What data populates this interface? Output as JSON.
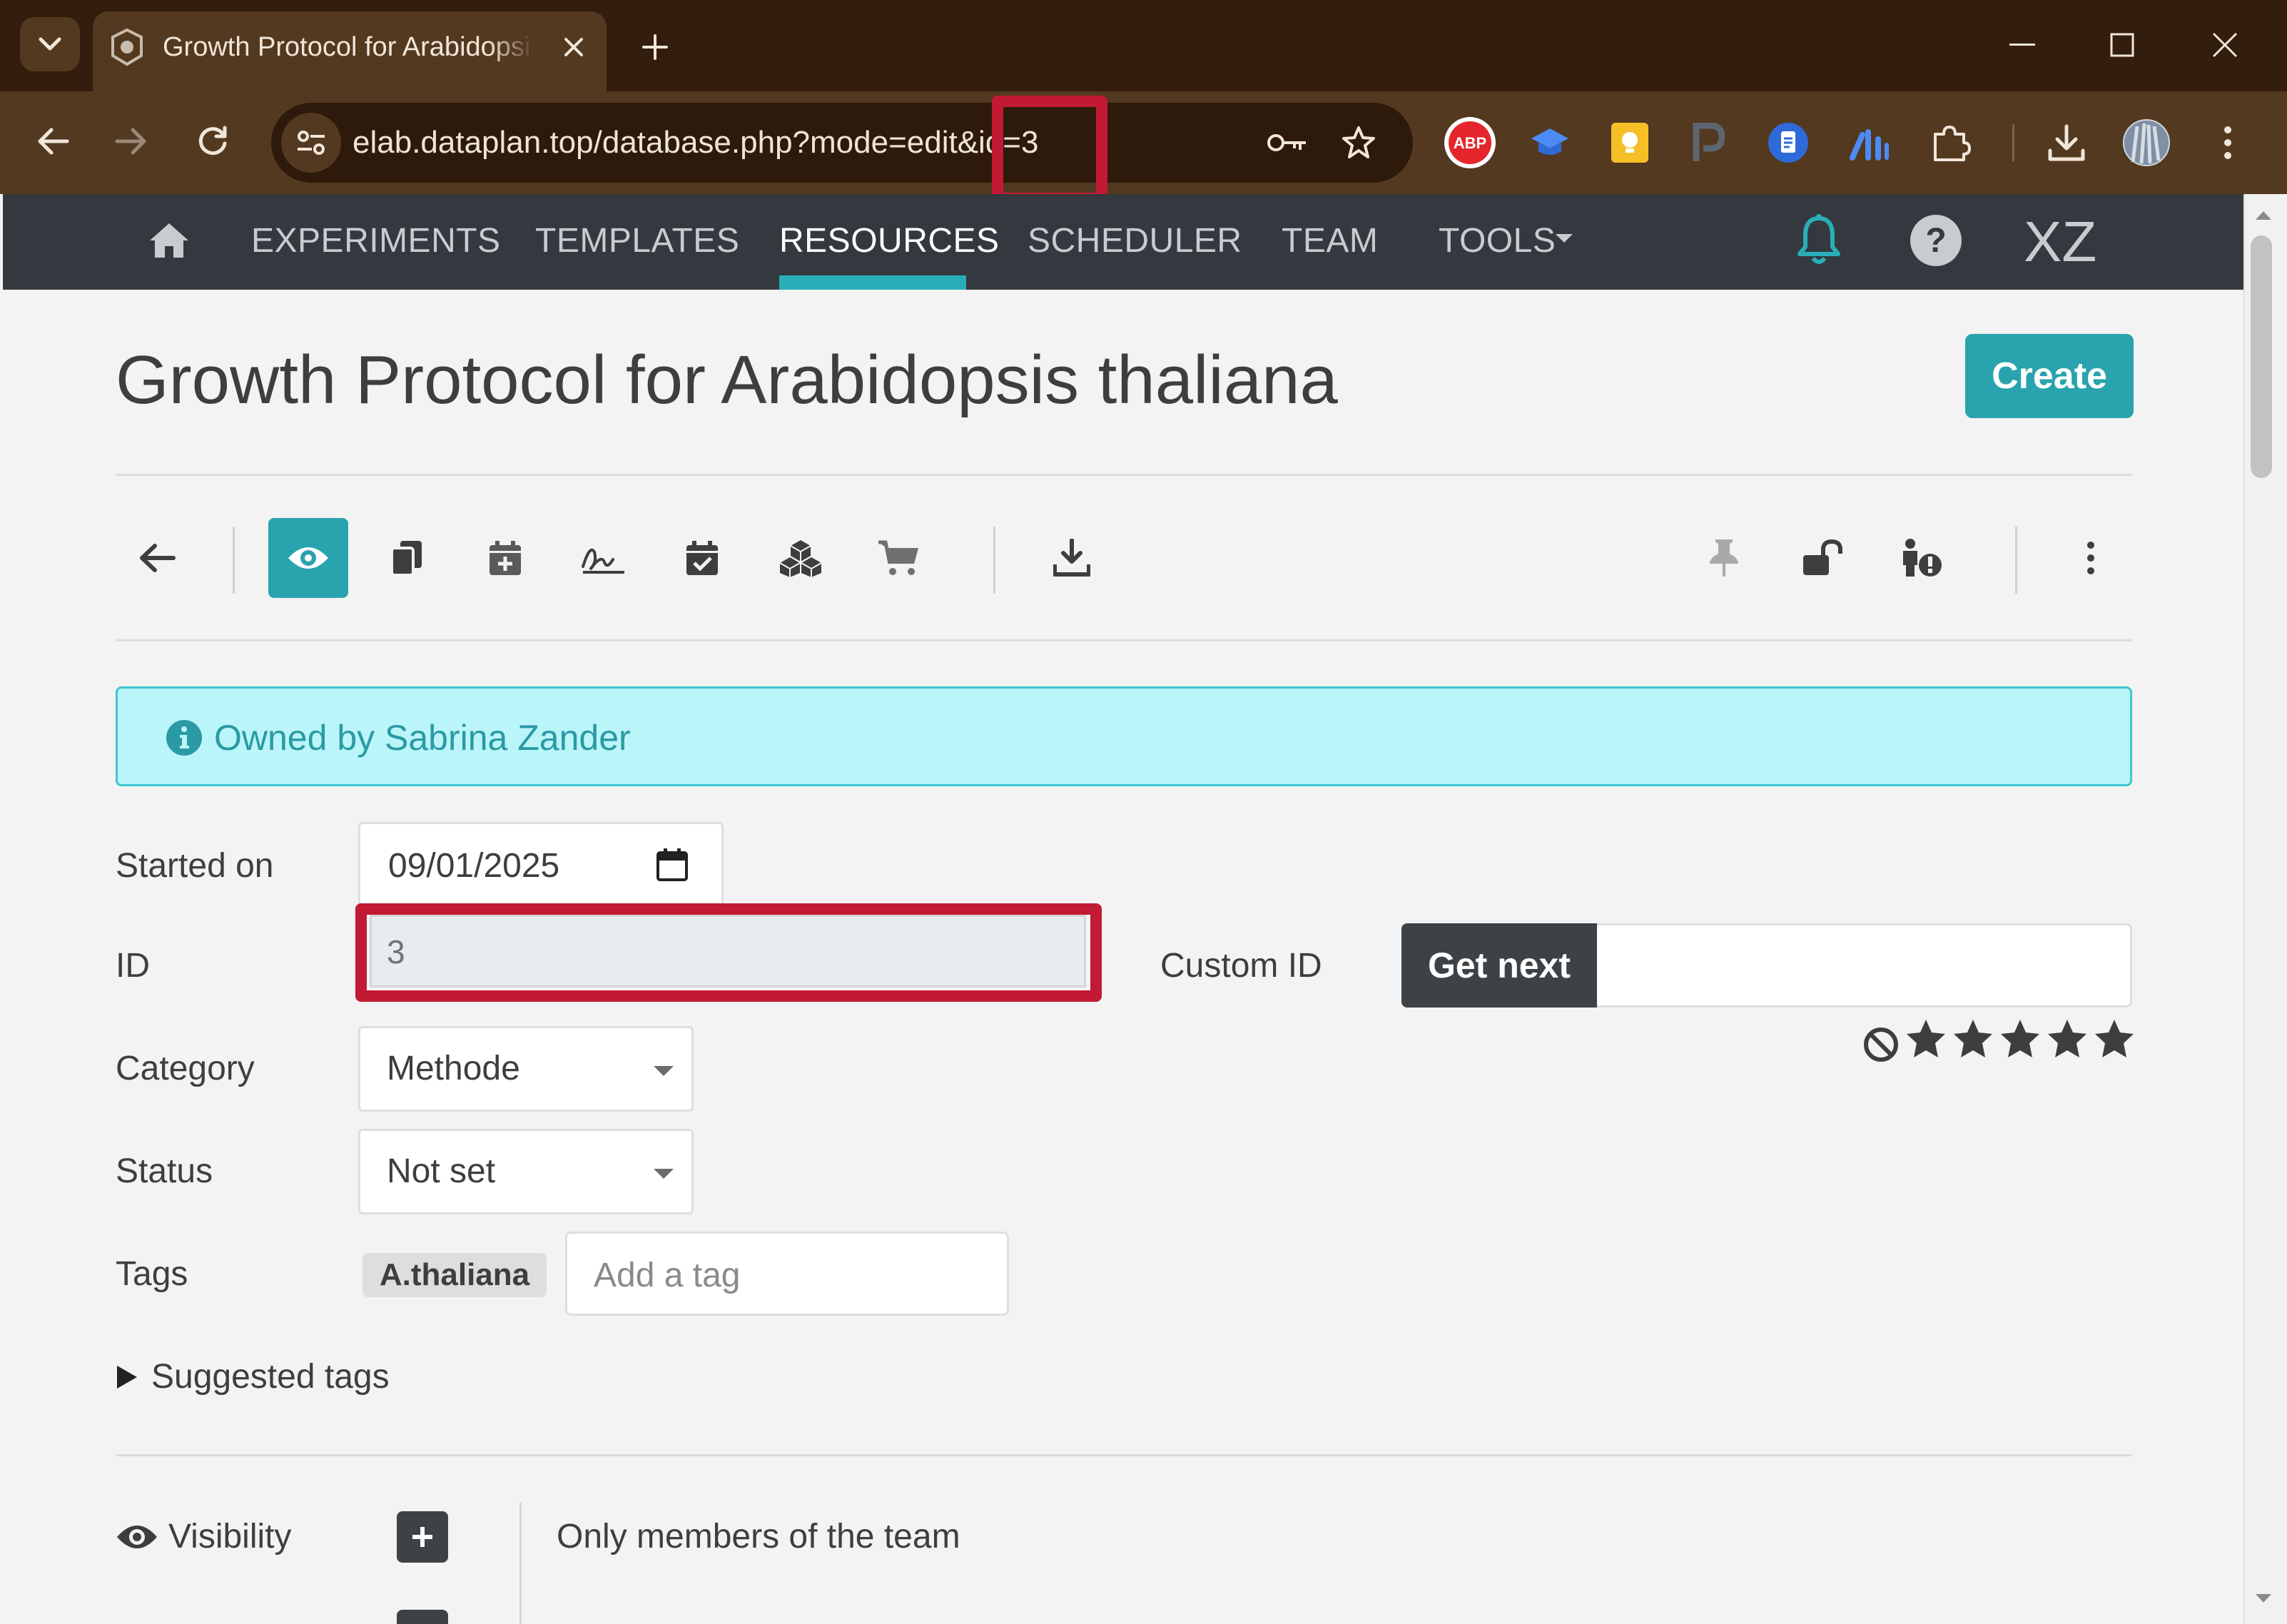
{
  "browser": {
    "tab_title": "Growth Protocol for Arabidopsis thaliana",
    "url": "elab.dataplan.top/database.php?mode=edit&id=3",
    "icons": [
      "tab-search-icon",
      "favicon-icon",
      "close-tab-icon",
      "new-tab-icon",
      "minimize-icon",
      "maximize-icon",
      "close-window-icon",
      "back-icon",
      "forward-icon",
      "reload-icon",
      "site-settings-icon",
      "password-key-icon",
      "bookmark-star-icon",
      "adblock-extension-icon",
      "extension-icons",
      "puzzle-extensions-icon",
      "downloads-icon",
      "profile-avatar",
      "kebab-menu-icon"
    ]
  },
  "nav": {
    "items": [
      "EXPERIMENTS",
      "TEMPLATES",
      "RESOURCES",
      "SCHEDULER",
      "TEAM",
      "TOOLS"
    ],
    "active": "RESOURCES",
    "initials": "XZ"
  },
  "page": {
    "title": "Growth Protocol for Arabidopsis thaliana",
    "create_label": "Create"
  },
  "alert": {
    "text": "Owned by Sabrina Zander"
  },
  "form": {
    "started_label": "Started on",
    "started_value": "09/01/2025",
    "id_label": "ID",
    "id_value": "3",
    "custom_id_label": "Custom ID",
    "get_next_label": "Get next",
    "category_label": "Category",
    "category_value": "Methode",
    "status_label": "Status",
    "status_value": "Not set",
    "tags_label": "Tags",
    "tags": [
      "A.thaliana"
    ],
    "tag_placeholder": "Add a tag",
    "suggested_label": "Suggested tags",
    "visibility_label": "Visibility",
    "visibility_value": "Only members of the team",
    "rating": 0,
    "rating_max": 5
  },
  "colors": {
    "accent": "#29a3ad",
    "navbar": "#33393f",
    "highlight": "#c21a34",
    "alert_bg": "#baf5f9"
  }
}
